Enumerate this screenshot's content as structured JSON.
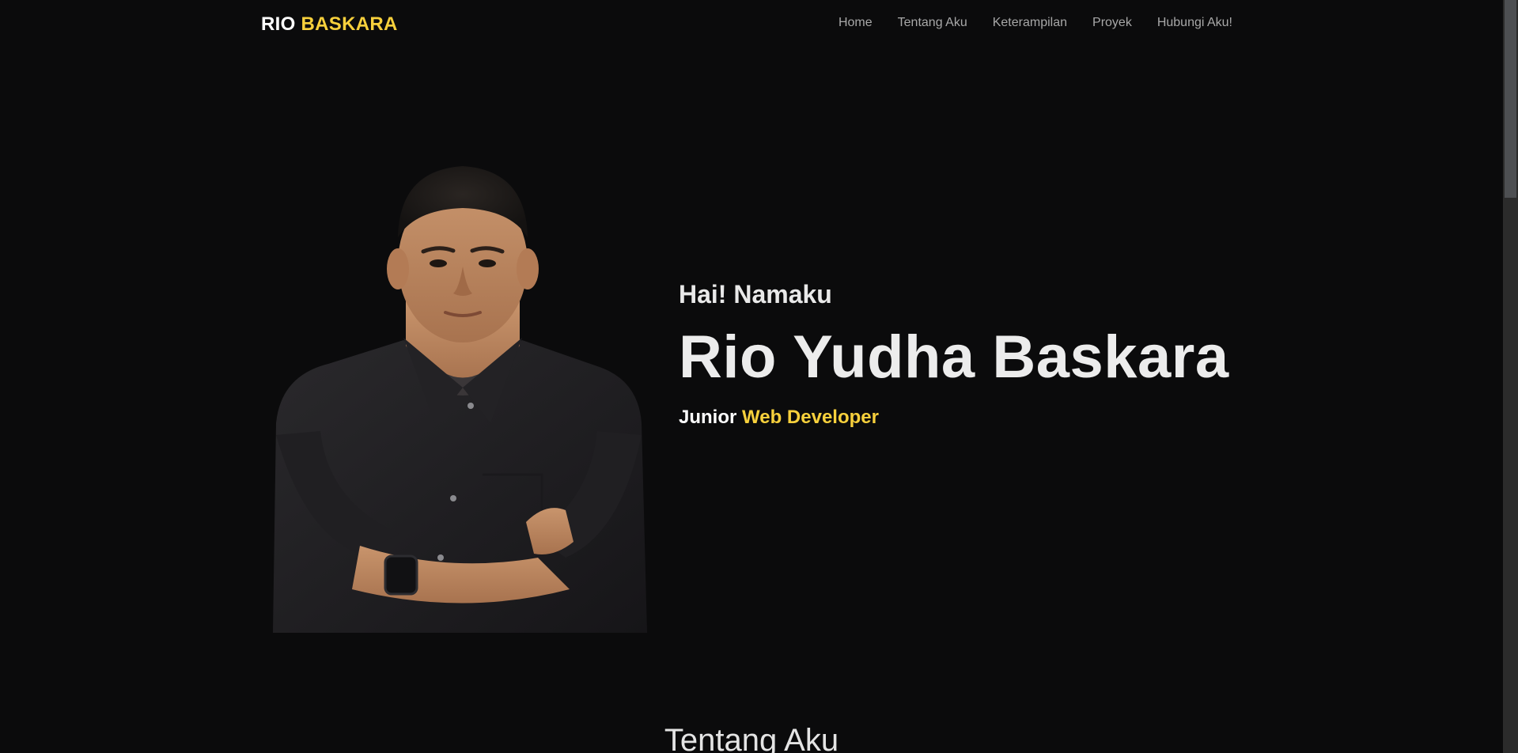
{
  "navbar": {
    "brand_first": "RIO",
    "brand_second": "BASKARA",
    "links": [
      "Home",
      "Tentang Aku",
      "Keterampilan",
      "Proyek",
      "Hubungi Aku!"
    ]
  },
  "hero": {
    "greeting": "Hai! Namaku",
    "name": "Rio Yudha Baskara",
    "role_prefix": "Junior",
    "role_highlight": "Web Developer"
  },
  "about": {
    "title": "Tentang Aku"
  },
  "colors": {
    "background": "#0b0b0c",
    "accent": "#f7d03c",
    "nav_text": "#a8a8a8",
    "heading_text": "#ececec"
  }
}
